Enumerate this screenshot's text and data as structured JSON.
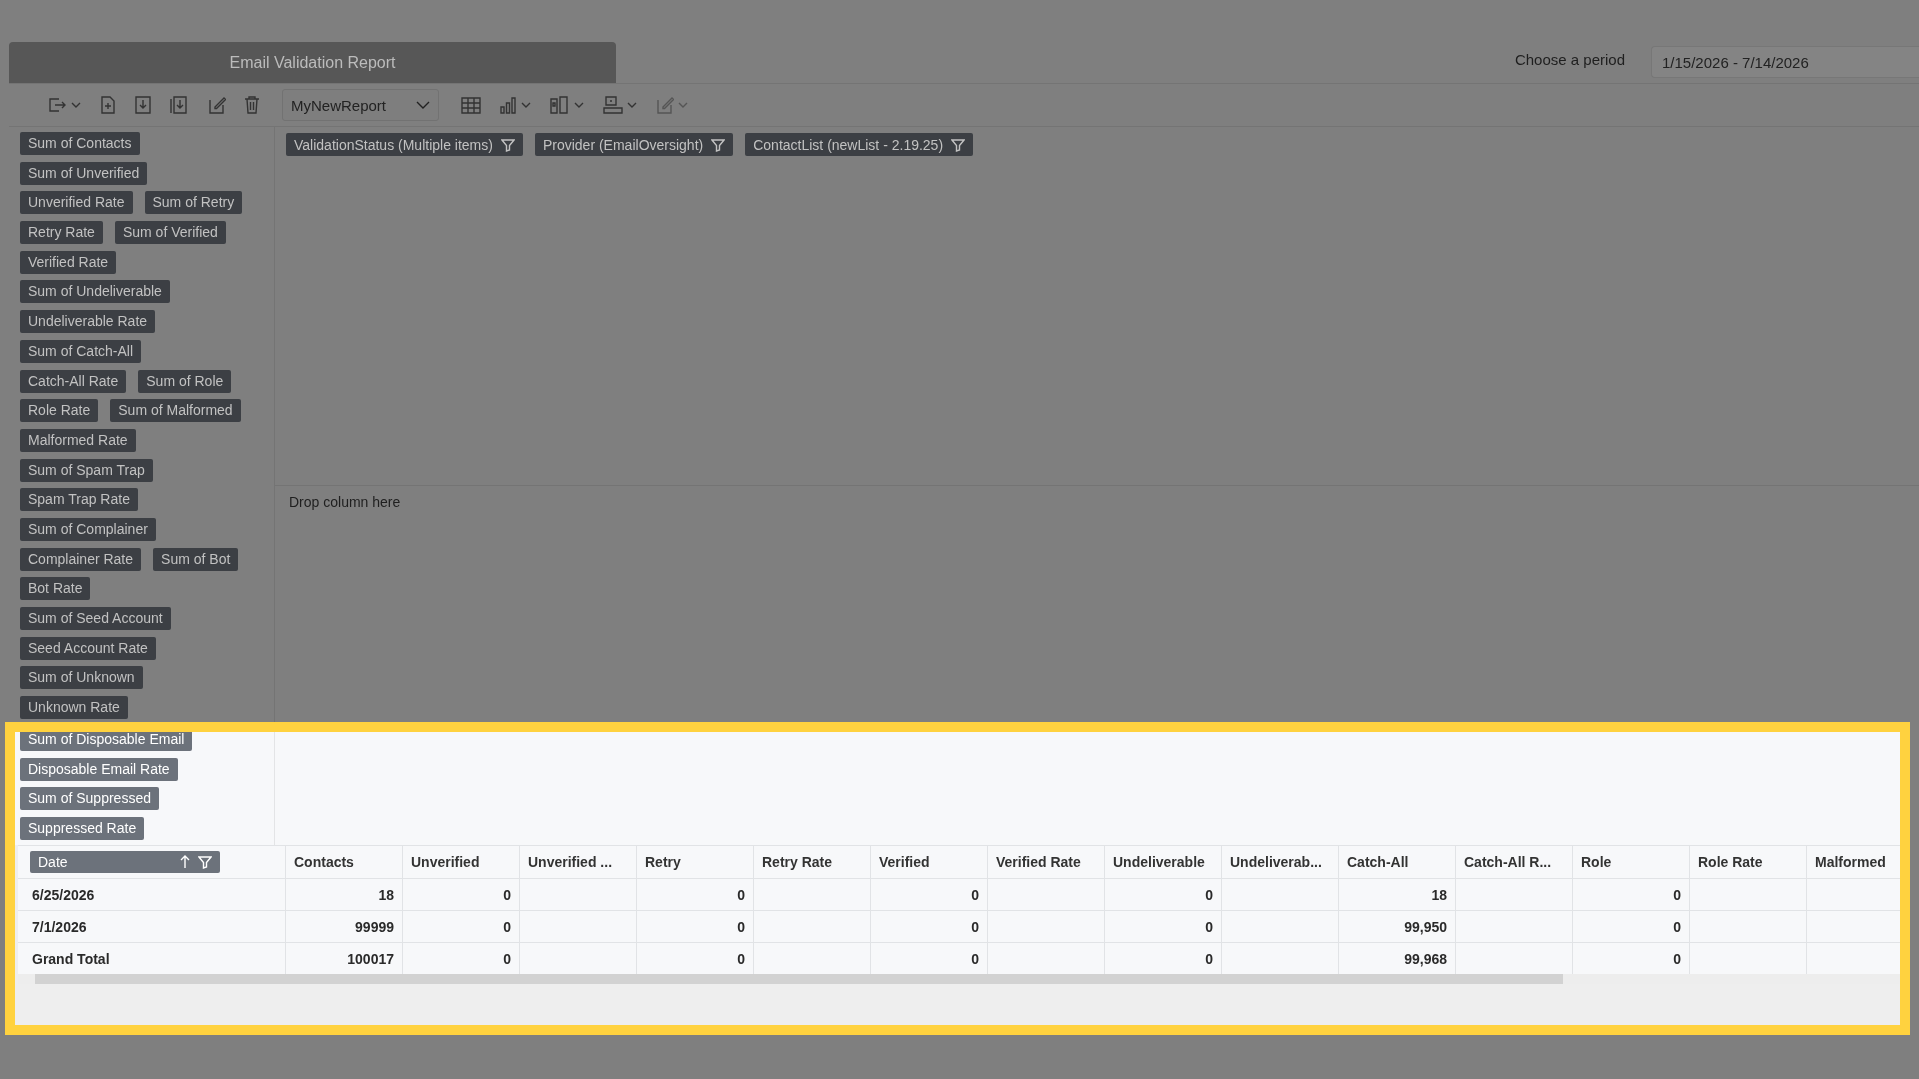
{
  "report": {
    "title": "Email Validation Report"
  },
  "period": {
    "label": "Choose a period",
    "value": "1/15/2026 - 7/14/2026"
  },
  "toolbar": {
    "report_select": "MyNewReport"
  },
  "field_rows": [
    [
      "Sum of Contacts"
    ],
    [
      "Sum of Unverified"
    ],
    [
      "Unverified Rate",
      "Sum of Retry"
    ],
    [
      "Retry Rate",
      "Sum of Verified"
    ],
    [
      "Verified Rate"
    ],
    [
      "Sum of Undeliverable"
    ],
    [
      "Undeliverable Rate"
    ],
    [
      "Sum of Catch-All"
    ],
    [
      "Catch-All Rate",
      "Sum of Role"
    ],
    [
      "Role Rate",
      "Sum of Malformed"
    ],
    [
      "Malformed Rate"
    ],
    [
      "Sum of Spam Trap"
    ],
    [
      "Spam Trap Rate"
    ],
    [
      "Sum of Complainer"
    ],
    [
      "Complainer Rate",
      "Sum of Bot"
    ],
    [
      "Bot Rate"
    ],
    [
      "Sum of Seed Account"
    ],
    [
      "Seed Account Rate"
    ],
    [
      "Sum of Unknown"
    ],
    [
      "Unknown Rate"
    ]
  ],
  "filters": [
    "ValidationStatus (Multiple items)",
    "Provider (EmailOversight)",
    "ContactList (newList - 2.19.25)"
  ],
  "drop_zone": "Drop column here",
  "highlighted_section": {
    "field_rows": [
      [
        "Sum of Disposable Email"
      ],
      [
        "Disposable Email Rate"
      ],
      [
        "Sum of Suppressed"
      ],
      [
        "Suppressed Rate"
      ]
    ],
    "table": {
      "row_header": "Date",
      "columns": [
        "Contacts",
        "Unverified",
        "Unverified ...",
        "Retry",
        "Retry Rate",
        "Verified",
        "Verified Rate",
        "Undeliverable",
        "Undeliverab...",
        "Catch-All",
        "Catch-All R...",
        "Role",
        "Role Rate",
        "Malformed"
      ],
      "rows": [
        {
          "label": "6/25/2026",
          "cells": [
            "18",
            "0",
            null,
            "0",
            null,
            "0",
            null,
            "0",
            null,
            "18",
            null,
            "0",
            null,
            null
          ]
        },
        {
          "label": "7/1/2026",
          "cells": [
            "99999",
            "0",
            null,
            "0",
            null,
            "0",
            null,
            "0",
            null,
            "99,950",
            null,
            "0",
            null,
            null
          ]
        },
        {
          "label": "Grand Total",
          "cells": [
            "100017",
            "0",
            null,
            "0",
            null,
            "0",
            null,
            "0",
            null,
            "99,968",
            null,
            "0",
            null,
            null
          ]
        }
      ]
    }
  }
}
